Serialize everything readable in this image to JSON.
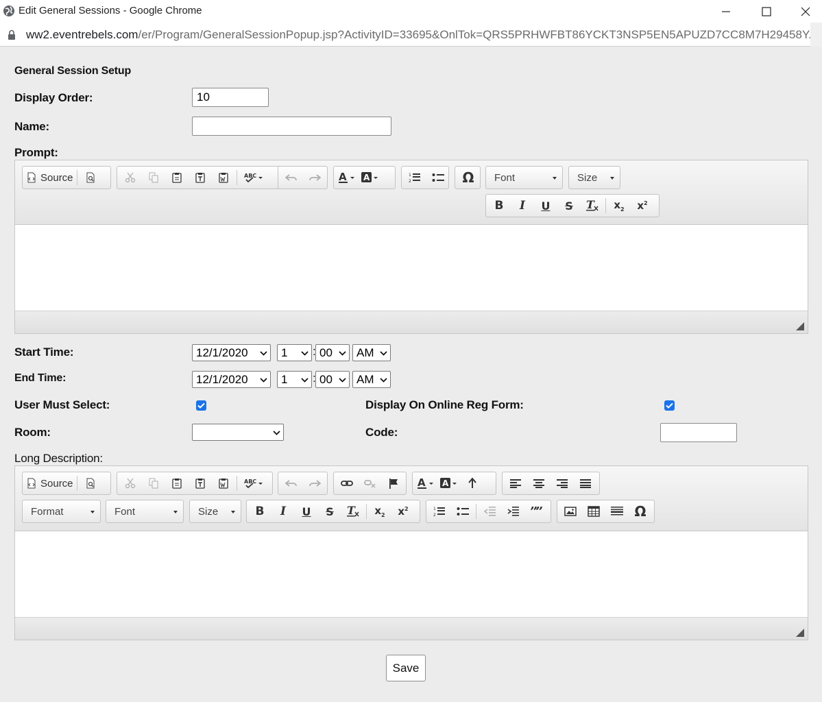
{
  "window": {
    "title": "Edit General Sessions - Google Chrome",
    "url_host": "ww2.eventrebels.com",
    "url_path": "/er/Program/GeneralSessionPopup.jsp?ActivityID=33695&OnlTok=QRS5PRHWFBT86YCKT3NSP5EN5APUZD7CC8M7H29458Y..."
  },
  "form": {
    "section_title": "General Session Setup",
    "display_order": {
      "label": "Display Order:",
      "value": "10"
    },
    "name": {
      "label": "Name:",
      "value": ""
    },
    "prompt_label": "Prompt:",
    "start_time": {
      "label": "Start Time:",
      "date": "12/1/2020",
      "hour": "1",
      "minute": "00",
      "ampm": "AM"
    },
    "end_time": {
      "label": "End Time:",
      "date": "12/1/2020",
      "hour": "1",
      "minute": "00",
      "ampm": "AM"
    },
    "time_separator": ":",
    "user_must_select": {
      "label": "User Must Select:",
      "checked": true
    },
    "display_online": {
      "label": "Display On Online Reg Form:",
      "checked": true
    },
    "room": {
      "label": "Room:",
      "value": ""
    },
    "code": {
      "label": "Code:",
      "value": ""
    },
    "long_description_label": "Long Description:",
    "save_label": "Save"
  },
  "editor": {
    "source_label": "Source",
    "font_label": "Font",
    "size_label": "Size",
    "format_label": "Format"
  },
  "colors": {
    "page_bg": "#ececec",
    "checkbox": "#1a73e8"
  }
}
